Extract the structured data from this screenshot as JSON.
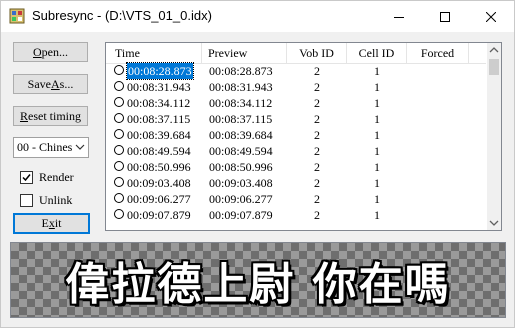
{
  "window": {
    "title": "Subresync - (D:\\VTS_01_0.idx)"
  },
  "buttons": {
    "open": {
      "pre": "",
      "ul": "O",
      "post": "pen..."
    },
    "save_as": {
      "pre": "Save ",
      "ul": "A",
      "post": "s..."
    },
    "reset_timing": {
      "pre": "",
      "ul": "R",
      "post": "eset timing"
    },
    "exit": {
      "pre": "E",
      "ul": "x",
      "post": "it"
    }
  },
  "language_select": {
    "value": "00 - Chines"
  },
  "checkboxes": {
    "render": {
      "label": "Render",
      "checked": true
    },
    "unlink": {
      "label": "Unlink",
      "checked": false
    }
  },
  "list": {
    "columns": [
      "Time",
      "Preview",
      "Vob ID",
      "Cell ID",
      "Forced"
    ],
    "rows": [
      {
        "time": "00:08:28.873",
        "preview": "00:08:28.873",
        "vob": "2",
        "cell": "1",
        "forced": "",
        "selected": true
      },
      {
        "time": "00:08:31.943",
        "preview": "00:08:31.943",
        "vob": "2",
        "cell": "1",
        "forced": ""
      },
      {
        "time": "00:08:34.112",
        "preview": "00:08:34.112",
        "vob": "2",
        "cell": "1",
        "forced": ""
      },
      {
        "time": "00:08:37.115",
        "preview": "00:08:37.115",
        "vob": "2",
        "cell": "1",
        "forced": ""
      },
      {
        "time": "00:08:39.684",
        "preview": "00:08:39.684",
        "vob": "2",
        "cell": "1",
        "forced": ""
      },
      {
        "time": "00:08:49.594",
        "preview": "00:08:49.594",
        "vob": "2",
        "cell": "1",
        "forced": ""
      },
      {
        "time": "00:08:50.996",
        "preview": "00:08:50.996",
        "vob": "2",
        "cell": "1",
        "forced": ""
      },
      {
        "time": "00:09:03.408",
        "preview": "00:09:03.408",
        "vob": "2",
        "cell": "1",
        "forced": ""
      },
      {
        "time": "00:09:06.277",
        "preview": "00:09:06.277",
        "vob": "2",
        "cell": "1",
        "forced": ""
      },
      {
        "time": "00:09:07.879",
        "preview": "00:09:07.879",
        "vob": "2",
        "cell": "1",
        "forced": ""
      }
    ]
  },
  "preview": {
    "subtitle_text": "偉拉德上尉 你在嗎"
  },
  "colors": {
    "selection": "#0078d7",
    "focus_border": "#0078d7"
  },
  "icons": {
    "app": "subtitle-app-icon",
    "minimize": "minimize-icon",
    "maximize": "maximize-icon",
    "close": "close-icon"
  }
}
